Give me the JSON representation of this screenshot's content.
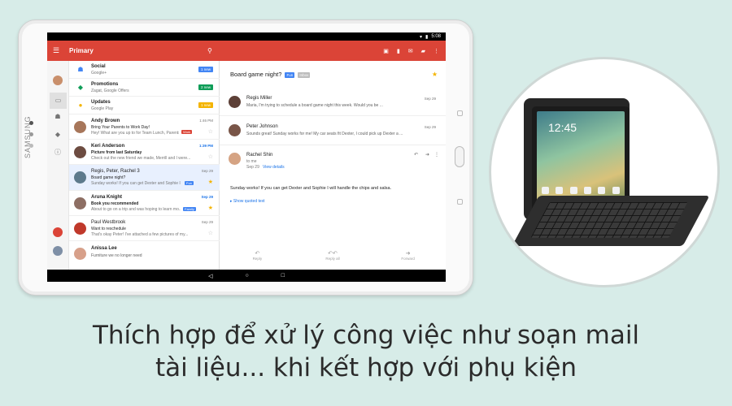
{
  "status_bar": {
    "time": "5:08"
  },
  "app_bar": {
    "title": "Primary"
  },
  "tablet_brand": "SAMSUNG",
  "inbox": [
    {
      "kind": "category",
      "sender": "Social",
      "subtitle": "Google+",
      "badge": "1 new",
      "badge_color": "#4285f4",
      "icon": "people-icon",
      "icon_color": "#4285f4"
    },
    {
      "kind": "category",
      "sender": "Promotions",
      "subtitle": "Zagat, Google Offers",
      "badge": "2 new",
      "badge_color": "#0f9d58",
      "icon": "tag-icon",
      "icon_color": "#0f9d58"
    },
    {
      "kind": "category",
      "sender": "Updates",
      "subtitle": "Google Play",
      "badge": "1 new",
      "badge_color": "#f4b400",
      "icon": "info-icon",
      "icon_color": "#f4b400"
    },
    {
      "kind": "mail",
      "sender": "Andy Brown",
      "subject": "Bring Your Parents to Work Day!",
      "snippet": "Hey! What are you up to for Team Lunch, Parents...",
      "time": "1:46 PM",
      "chip": "Work",
      "chip_color": "#db4437",
      "starred": false
    },
    {
      "kind": "mail",
      "sender": "Keri Anderson",
      "subject": "Picture from last Saturday",
      "snippet": "Check out the new friend we made, Merrill and I were...",
      "time": "1:39 PM",
      "unread": true,
      "starred": false
    },
    {
      "kind": "mail",
      "sender": "Regis, Peter, Rachel  3",
      "subject": "Board game night?",
      "snippet": "Sunday works! If you can get Dexter and Sophie I will...",
      "time": "Sep 29",
      "chip": "Fun",
      "chip_color": "#4285f4",
      "starred": true,
      "selected": true
    },
    {
      "kind": "mail",
      "sender": "Aruna Knight",
      "subject": "Book you recommended",
      "snippet": "About to go on a trip and was hoping to learn mo...",
      "time": "Sep 29",
      "chip": "Family",
      "chip_color": "#4285f4",
      "unread": true,
      "starred": true
    },
    {
      "kind": "mail",
      "sender": "Paul Westbrook",
      "subject": "Want to reschedule",
      "snippet": "That's okay Peter! I've attached a few pictures of my...",
      "time": "Sep 29",
      "starred": false
    },
    {
      "kind": "mail",
      "sender": "Anissa Lee",
      "subject": "Furniture we no longer need",
      "snippet": "",
      "time": "",
      "starred": false
    }
  ],
  "detail": {
    "subject": "Board game night?",
    "labels": [
      {
        "text": "Fun",
        "color": "#4285f4"
      },
      {
        "text": "Inbox",
        "color": "#bdbdbd"
      }
    ],
    "messages": [
      {
        "sender": "Regis Miller",
        "snippet": "Maria, I'm trying to schedule a board game night this week. Would you be ...",
        "date": "Sep 29"
      },
      {
        "sender": "Peter Johnson",
        "snippet": "Sounds great! Sunday works for me! My car seats fit Dexter, I could pick up Dexter a ...",
        "date": "Sep 29"
      },
      {
        "sender": "Rachel Shin",
        "to": "to me",
        "date_line": "Sep 29",
        "view_details": "View details",
        "body": "Sunday works! If you can get Dexter and Sophie I will handle the chips and salsa.",
        "quoted": "Show quoted text"
      }
    ],
    "actions": {
      "reply": "Reply",
      "reply_all": "Reply all",
      "forward": "Forward"
    }
  },
  "caption": {
    "line1": "Thích hợp để xử lý công việc như soạn mail",
    "line2": "tài liệu... khi kết hợp với phụ kiện"
  },
  "accessory_tablet_clock": "12:45"
}
